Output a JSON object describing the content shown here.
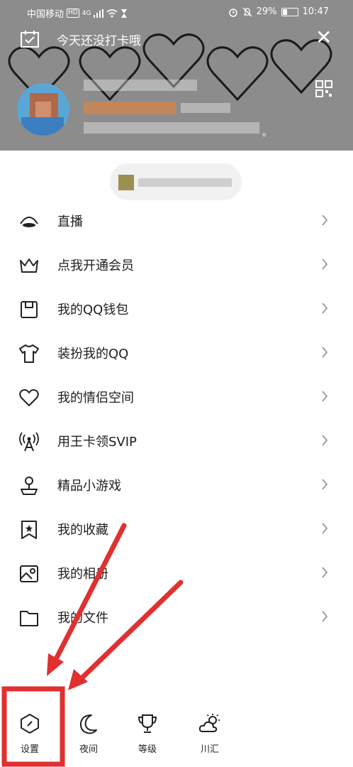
{
  "status_bar": {
    "carrier": "中国移动",
    "network_badge": "HD",
    "network_type": "4G",
    "battery": "29%",
    "time": "10:47"
  },
  "header": {
    "checkin_text": "今天还没打卡哦",
    "signature_tail": "。",
    "bg_color": "#8c8c8c"
  },
  "menu": {
    "items": [
      {
        "label": "直播",
        "icon": "live-icon"
      },
      {
        "label": "点我开通会员",
        "icon": "crown-icon"
      },
      {
        "label": "我的QQ钱包",
        "icon": "wallet-icon"
      },
      {
        "label": "装扮我的QQ",
        "icon": "tshirt-icon"
      },
      {
        "label": "我的情侣空间",
        "icon": "heart-icon"
      },
      {
        "label": "用王卡领SVIP",
        "icon": "signal-tower-icon"
      },
      {
        "label": "精品小游戏",
        "icon": "joystick-icon"
      },
      {
        "label": "我的收藏",
        "icon": "bookmark-star-icon"
      },
      {
        "label": "我的相册",
        "icon": "photo-album-icon"
      },
      {
        "label": "我的文件",
        "icon": "folder-icon"
      }
    ]
  },
  "bottom_bar": {
    "settings": "设置",
    "night": "夜间",
    "level": "等级",
    "weather": "川汇"
  },
  "annotation_color": "#e03030"
}
